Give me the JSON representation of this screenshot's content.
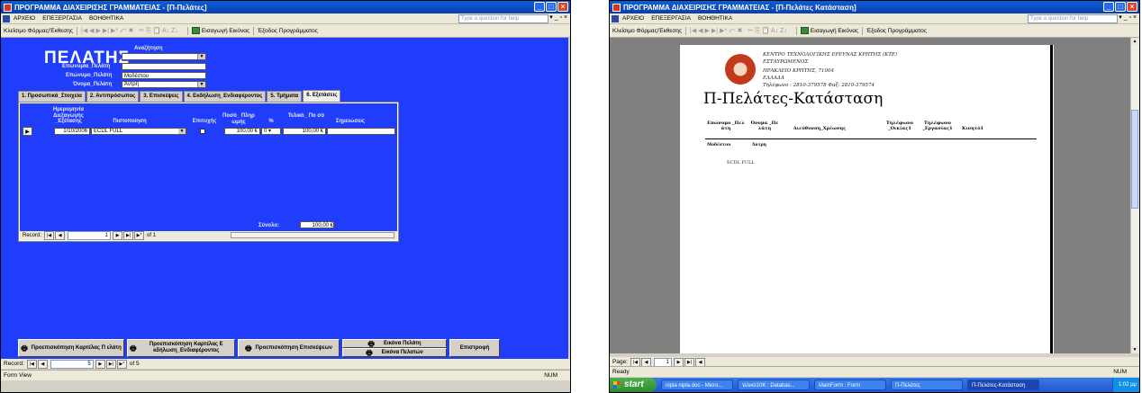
{
  "left": {
    "title": "ΠΡΟΓΡΑΜΜΑ ΔΙΑΧΕΙΡΙΣΗΣ ΓΡΑΜΜΑΤΕΙΑΣ - [Π-Πελάτες]",
    "menu": [
      "ΑΡΧΕΙΟ",
      "ΕΠΕΞΕΡΓΑΣΙΑ",
      "ΒΟΗΘΗΤΙΚΑ"
    ],
    "help_placeholder": "Type a question for help",
    "toolbar": {
      "close_label": "Κλείσιμο Φόρμας/Έκθεσης",
      "import_image": "Εισαγωγή Εικόνας",
      "exit": "Έξοδος Προγράμματος"
    },
    "form": {
      "heading": "ΠΕΛΑΤΗΣ",
      "search_label": "Αναζήτηση",
      "surname_label": "Επωνυμία_Πελάτη",
      "surname_value": "",
      "name_label": "Επώνυμο_Πελάτη",
      "name_value": "Μοδέστου",
      "first_label": "Όνομα_Πελάτη",
      "first_value": "Άντρη"
    },
    "tabs": [
      "1. Προσωπικά_Στοιχεία",
      "2. Αντιπρόσωπος",
      "3. Επισκέψεις",
      "4. Εκδήλωση_Ενδιαφέροντος",
      "5. Τμήματα",
      "6. Εξετάσεις"
    ],
    "subform": {
      "columns": [
        "Ημερομηνία Διεξαγωγής _Εξέτασης",
        "Πιστοποίηση",
        "Επιτυχής",
        "Ποσό_ Πληρ ωμής",
        "%",
        "Τελικό_ Πο σό",
        "Σημειώσεις"
      ],
      "row": {
        "date": "1/10/2006",
        "cert": "ECDL FULL",
        "amount": "100,00 €",
        "pct": "0",
        "final": "100,00 €"
      },
      "total_label": "Σύνολο:",
      "total_value": "100,00 €",
      "record_label": "Record:",
      "record_num": "1",
      "record_of": "of 1"
    },
    "buttons": [
      "Προεπισκόπηση Καρτέλας Π ελάτη",
      "Προεπισκόπηση Καρτέλας Ε κδήλωση_Ενδιαφέροντος",
      "Προεπισκόπηση Επισκέψεων",
      "Εικόνα Πελάτη",
      "Εικόνα Πελατών",
      "Επιστροφή"
    ],
    "record_label": "Record:",
    "record_num": "5",
    "record_of": "of 5",
    "status": "Form View",
    "num": "NUM"
  },
  "right": {
    "title": "ΠΡΟΓΡΑΜΜΑ ΔΙΑΧΕΙΡΙΣΗΣ ΓΡΑΜΜΑΤΕΙΑΣ - [Π-Πελάτες Κατάσταση]",
    "menu": [
      "ΑΡΧΕΙΟ",
      "ΕΠΕΞΕΡΓΑΣΙΑ",
      "ΒΟΗΘΗΤΙΚΑ"
    ],
    "help_placeholder": "Type a question for help",
    "toolbar": {
      "close_label": "Κλείσιμο Φόρμας/Έκθεσης",
      "import_image": "Εισαγωγή Εικόνας",
      "exit": "Έξοδος Προγράμματος"
    },
    "report": {
      "org": [
        "ΚΕΝΤΡΟ ΤΕΧΝΟΛΟΓΙΚΗΣ ΕΡΕΥΝΑΣ ΚΡΗΤΗΣ (ΚΤΕ)",
        "ΕΣΤΑΥΡΩΜΕΝΟΣ",
        "ΗΡΑΚΛΕΙΟ ΚΡΗΤΗΣ,   71004",
        "ΕΛΛΑΔΑ",
        "Τηλέφωνο : 2810-379578  Φαξ: 2810-379574"
      ],
      "title": "Π-Πελάτες-Κατάσταση",
      "headers": [
        "Επώνυμο _Πελ άτη",
        "Όνομα _Πε λάτη",
        "Διεύθυνση_Χρέωσης",
        "Τηλέφωνο _Οικίας1",
        "Τηλέφωνο _Εργασίας1",
        "Κινητό1"
      ],
      "row_surname": "Μοδέστου",
      "row_name": "Άντρη",
      "row_cert": "ECDL FULL"
    },
    "page_label": "Page:",
    "page_num": "1",
    "status": "Ready",
    "num": "NUM",
    "taskbar": {
      "start": "start",
      "items": [
        "nipla nipla.doc - Micro...",
        "τελικό10Κ : Databas...",
        "MainForm : Form",
        "Π-Πελάτες",
        "Π-Πελάτες-Κατάσταση"
      ],
      "clock": "1:02 μμ"
    }
  }
}
